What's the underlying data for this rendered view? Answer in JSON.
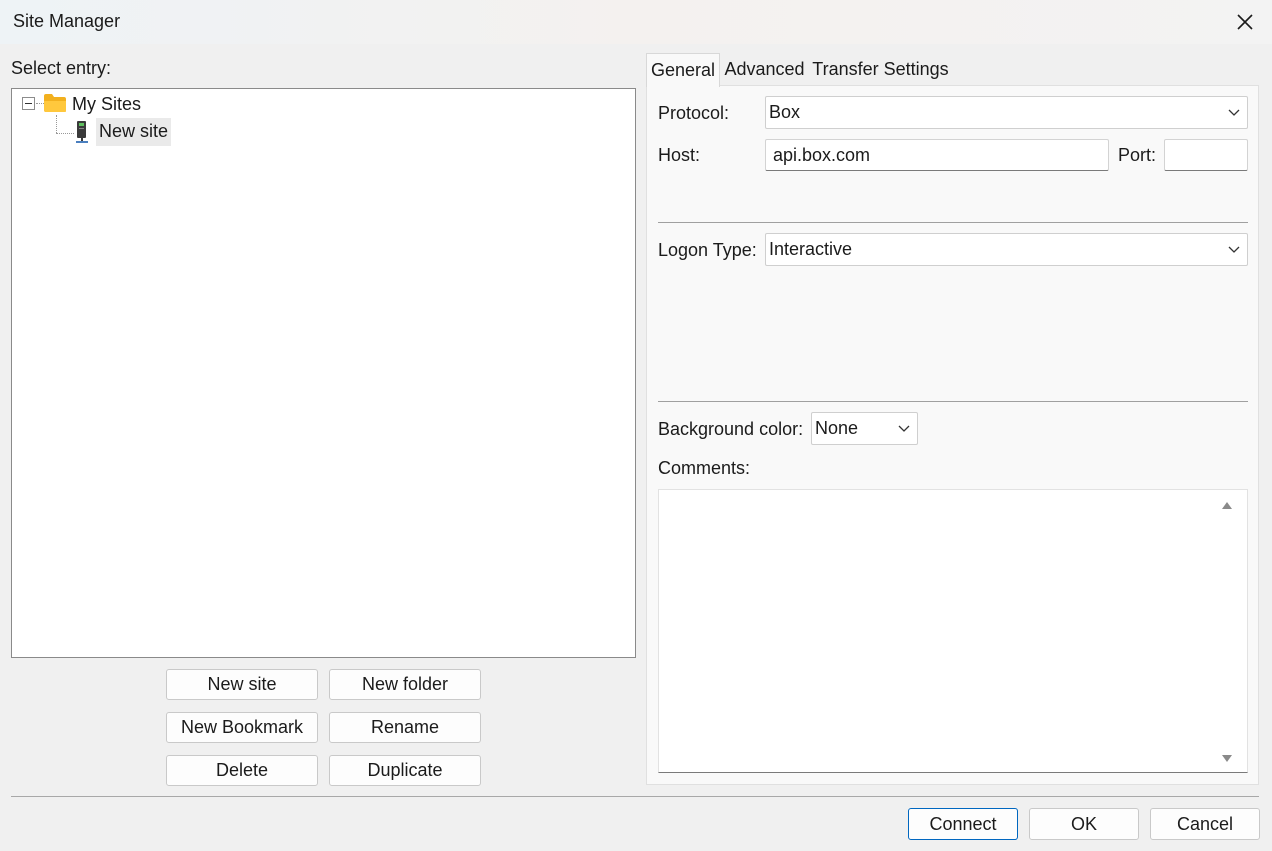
{
  "window": {
    "title": "Site Manager"
  },
  "left_panel": {
    "select_entry_label": "Select entry:",
    "tree": {
      "root": {
        "label": "My Sites",
        "expanded": true,
        "icon": "folder-icon",
        "children": [
          {
            "label": "New site",
            "icon": "server-icon",
            "selected": true
          }
        ]
      }
    },
    "buttons": {
      "new_site": "New site",
      "new_folder": "New folder",
      "new_bookmark": "New Bookmark",
      "rename": "Rename",
      "delete": "Delete",
      "duplicate": "Duplicate"
    }
  },
  "tabs": [
    {
      "label": "General",
      "active": true
    },
    {
      "label": "Advanced",
      "active": false
    },
    {
      "label": "Transfer Settings",
      "active": false
    }
  ],
  "general": {
    "protocol_label": "Protocol:",
    "protocol_value": "Box",
    "host_label": "Host:",
    "host_value": "api.box.com",
    "port_label": "Port:",
    "port_value": "",
    "logon_type_label": "Logon Type:",
    "logon_type_value": "Interactive",
    "background_color_label": "Background color:",
    "background_color_value": "None",
    "comments_label": "Comments:",
    "comments_value": ""
  },
  "footer": {
    "connect": "Connect",
    "ok": "OK",
    "cancel": "Cancel"
  },
  "colors": {
    "accent": "#0067c0",
    "folder": "#f5b400",
    "window_bg": "#f0f0f0"
  }
}
